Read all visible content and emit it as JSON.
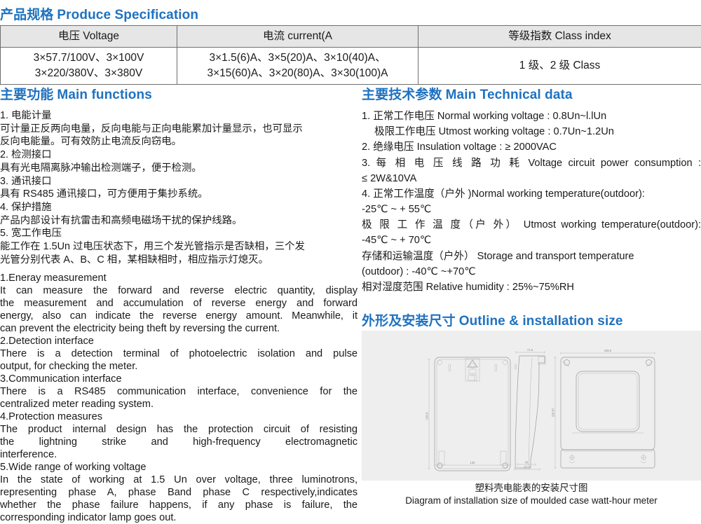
{
  "sections": {
    "spec": {
      "cn": "产品规格",
      "en": "Produce Specification"
    },
    "functions": {
      "cn": "主要功能",
      "en": "Main functions"
    },
    "technical": {
      "cn": "主要技术参数",
      "en": "Main Technical data"
    },
    "outline": {
      "cn": "外形及安装尺寸",
      "en": "Outline & installation size"
    }
  },
  "spec_table": {
    "headers": [
      "电压 Voltage",
      "电流 current(A",
      "等级指数 Class index"
    ],
    "rows": [
      {
        "voltage": [
          "3×57.7/100V、3×100V",
          "3×220/380V、3×380V"
        ],
        "current": [
          "3×1.5(6)A、3×5(20)A、3×10(40)A、",
          "3×15(60)A、3×20(80)A、3×30(100)A"
        ],
        "class_index": "1 级、2 级 Class"
      }
    ]
  },
  "main_functions_cn": [
    {
      "title": "1. 电能计量",
      "lines": [
        "可计量正反两向电量，反向电能与正向电能累加计量显示，也可显示",
        "反向电能量。可有效防止电流反向窃电。"
      ]
    },
    {
      "title": "2. 检测接口",
      "lines": [
        "具有光电隔离脉冲输出检测端子，便于检测。"
      ]
    },
    {
      "title": "3. 通讯接口",
      "lines": [
        "具有 RS485 通讯接口，可方便用于集抄系统。"
      ]
    },
    {
      "title": "4. 保护措施",
      "lines": [
        "产品内部设计有抗雷击和高频电磁场干扰的保护线路。"
      ]
    },
    {
      "title": "5. 宽工作电压",
      "lines": [
        "能工作在 1.5Un 过电压状态下，用三个发光管指示是否缺相，三个发",
        "光管分别代表 A、B、C 相，某相缺相时，相应指示灯熄灭。"
      ]
    }
  ],
  "main_functions_en": [
    {
      "title": "1.Eneray measurement",
      "lines": [
        "It can measure the forward and reverse electric quantity, display",
        "the measurement and accumulation of reverse energy and forward",
        "energy, also can indicate the reverse energy amount. Meanwhile, it",
        "can prevent the electricity being theft by reversing the current."
      ]
    },
    {
      "title": "2.Detection interface",
      "lines": [
        "There is a detection terminal of photoelectric isolation and pulse",
        "output, for checking the meter."
      ]
    },
    {
      "title": "3.Communication interface",
      "lines": [
        "There is a RS485 communication interface, convenience for the",
        "centralized meter reading system."
      ]
    },
    {
      "title": "4.Protection measures",
      "lines": [
        "The product internal design has the protection circuit of resisting",
        "the lightning strike and high-frequency electromagnetic",
        "interference."
      ]
    },
    {
      "title": "5.Wide range of working voltage",
      "lines": [
        "In the state of working at 1.5 Un over voltage, three luminotrons,",
        "representing phase A, phase Band phase C respectively,indicates",
        "whether the phase failure happens, if any phase is failure, the",
        "corresponding indicator lamp goes out."
      ]
    }
  ],
  "technical_data": [
    "1. 正常工作电压 Normal working voltage : 0.8Un~l.lUn",
    "极限工作电压 Utmost working voltage : 0.7Un~1.2Un",
    "2. 绝缘电压 Insulation voltage : ≥ 2000VAC",
    "3. 每 相 电 压 线 路 功 耗 Voltage circuit power consumption :",
    "≤ 2W&10VA",
    "4. 正常工作温度（户外 )Normal working temperature(outdoor):",
    "-25℃ ~ + 55℃",
    "极 限 工 作 温 度（户 外） Utmost working temperature(outdoor):",
    "-45℃ ~ + 70℃",
    "存储和运输温度（户外） Storage and transport temperature",
    "(outdoor) : -40℃ ~+70℃",
    "相对湿度范围 Relative humidity : 25%~75%RH"
  ],
  "diagram": {
    "caption_cn": "塑料壳电能表的安装尺寸图",
    "caption_en": "Diagram of installation size of moulded case watt-hour meter",
    "dimensions": {
      "back_view_height": "199.8",
      "back_view_width": "130",
      "side_view_width": "71.5",
      "side_view_bottom": "57.5",
      "side_view_bottom_inner": "45",
      "front_view_width": "165.5",
      "front_view_height": "228.87"
    }
  },
  "colors": {
    "accent_blue": "#1f72c0",
    "table_header_bg": "#e6e6e6",
    "table_border": "#6f6f6f",
    "panel_bg": "#eeeeee",
    "text": "#1a1a1a"
  }
}
